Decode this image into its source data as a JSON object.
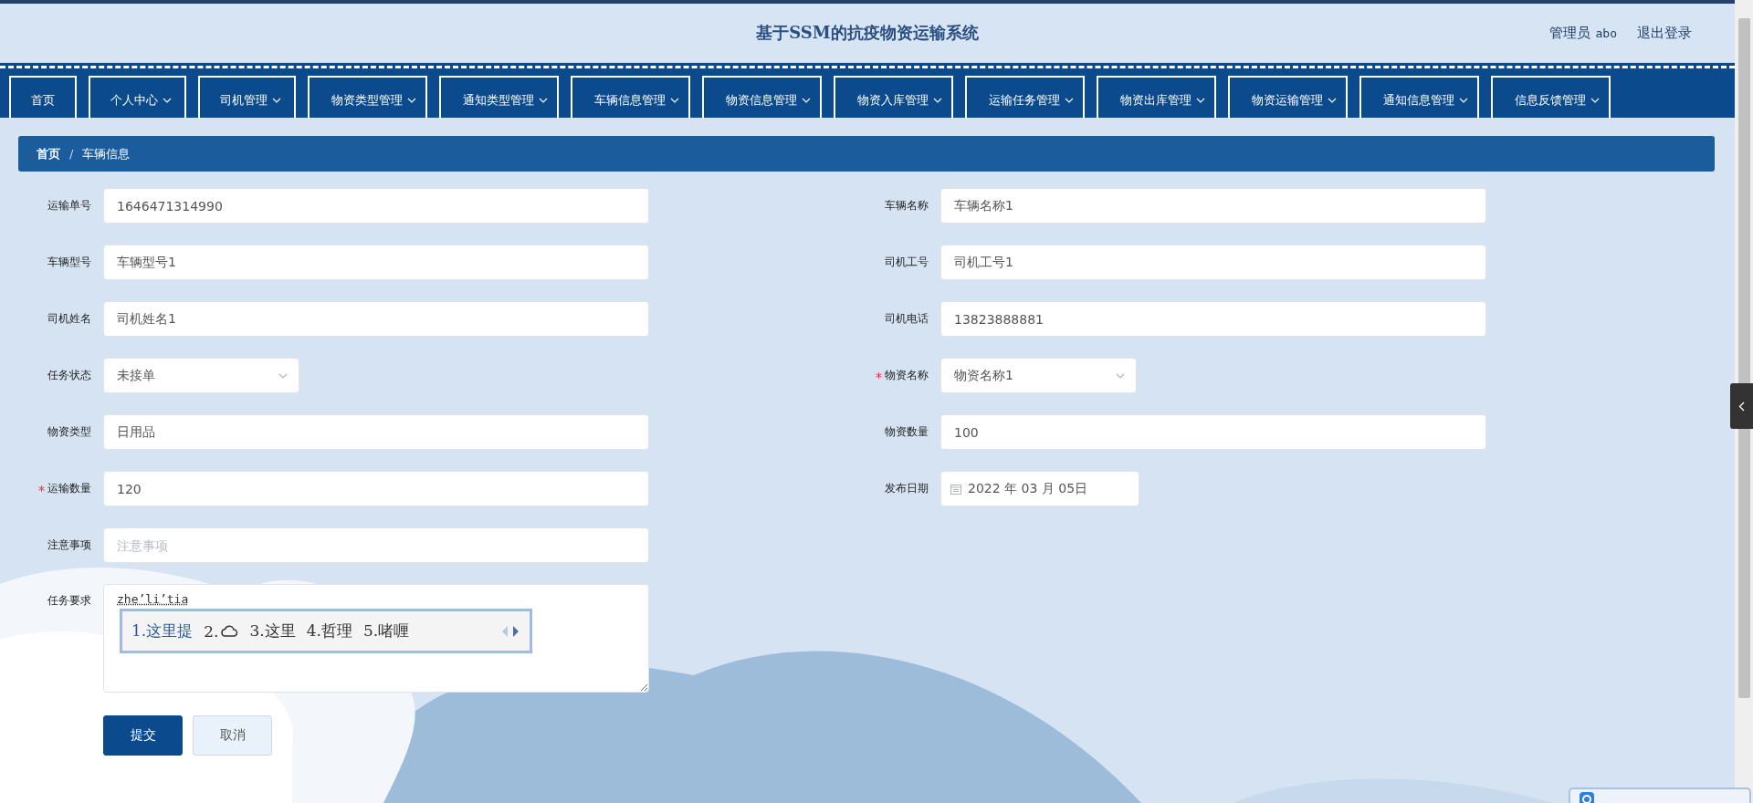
{
  "header": {
    "title": "基于SSM的抗疫物资运输系统",
    "user_role": "管理员",
    "user_name": "abo",
    "logout": "退出登录"
  },
  "nav": [
    {
      "label": "首页",
      "dropdown": false
    },
    {
      "label": "个人中心",
      "dropdown": true
    },
    {
      "label": "司机管理",
      "dropdown": true
    },
    {
      "label": "物资类型管理",
      "dropdown": true
    },
    {
      "label": "通知类型管理",
      "dropdown": true
    },
    {
      "label": "车辆信息管理",
      "dropdown": true
    },
    {
      "label": "物资信息管理",
      "dropdown": true
    },
    {
      "label": "物资入库管理",
      "dropdown": true
    },
    {
      "label": "运输任务管理",
      "dropdown": true
    },
    {
      "label": "物资出库管理",
      "dropdown": true
    },
    {
      "label": "物资运输管理",
      "dropdown": true
    },
    {
      "label": "通知信息管理",
      "dropdown": true
    },
    {
      "label": "信息反馈管理",
      "dropdown": true
    }
  ],
  "breadcrumb": {
    "items": [
      {
        "label": "首页",
        "current": false
      },
      {
        "label": "车辆信息",
        "current": true
      }
    ],
    "separator": "/"
  },
  "form_rows": [
    {
      "left": {
        "label": "运输单号",
        "kind": "text",
        "value": "1646471314990",
        "required": false
      },
      "right": {
        "label": "车辆名称",
        "kind": "text",
        "value": "车辆名称1",
        "required": false
      }
    },
    {
      "left": {
        "label": "车辆型号",
        "kind": "text",
        "value": "车辆型号1",
        "required": false
      },
      "right": {
        "label": "司机工号",
        "kind": "text",
        "value": "司机工号1",
        "required": false
      }
    },
    {
      "left": {
        "label": "司机姓名",
        "kind": "text",
        "value": "司机姓名1",
        "required": false
      },
      "right": {
        "label": "司机电话",
        "kind": "text",
        "value": "13823888881",
        "required": false
      }
    },
    {
      "left": {
        "label": "任务状态",
        "kind": "select",
        "value": "未接单",
        "required": false
      },
      "right": {
        "label": "物资名称",
        "kind": "select",
        "value": "物资名称1",
        "required": true
      }
    },
    {
      "left": {
        "label": "物资类型",
        "kind": "text",
        "value": "日用品",
        "required": false
      },
      "right": {
        "label": "物资数量",
        "kind": "text",
        "value": "100",
        "required": false
      }
    },
    {
      "left": {
        "label": "运输数量",
        "kind": "text",
        "value": "120",
        "required": true
      },
      "right": {
        "label": "发布日期",
        "kind": "date",
        "value": "2022 年 03 月 05日",
        "required": false
      }
    },
    {
      "left": {
        "label": "注意事项",
        "kind": "text",
        "placeholder": "注意事项",
        "required": false
      }
    },
    {
      "left": {
        "label": "任务要求",
        "kind": "textarea",
        "value": "zhe’li’tia",
        "required": false
      }
    }
  ],
  "ime_popup": {
    "candidates": [
      {
        "number": "1.",
        "text": "这里提",
        "kind": "word",
        "selected": true
      },
      {
        "number": "2.",
        "kind": "cloud",
        "selected": false
      },
      {
        "number": "3.",
        "text": "这里",
        "kind": "word",
        "selected": false
      },
      {
        "number": "4.",
        "text": "哲理",
        "kind": "word",
        "selected": false
      },
      {
        "number": "5.",
        "text": "啫喱",
        "kind": "word",
        "selected": false
      }
    ]
  },
  "buttons": [
    {
      "label": "提交",
      "kind": "primary"
    },
    {
      "label": "取消",
      "kind": "default"
    }
  ]
}
